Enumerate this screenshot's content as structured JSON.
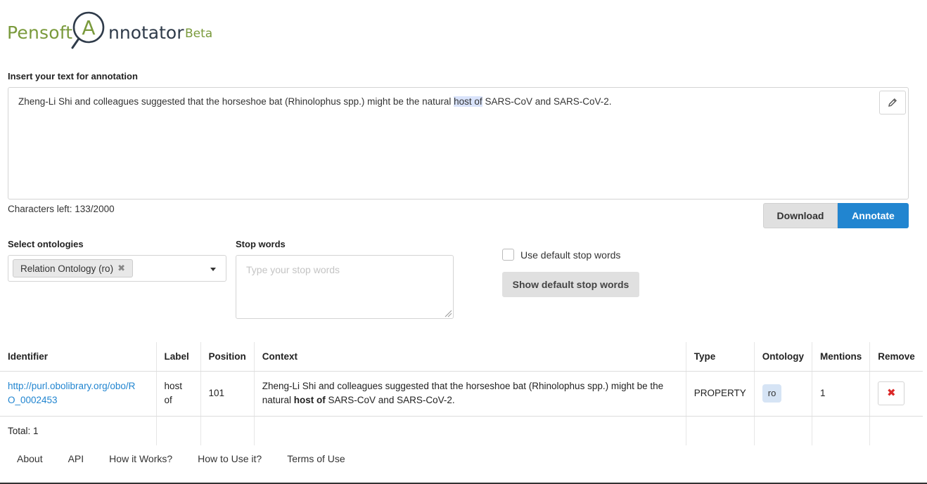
{
  "logo": {
    "pensoft": "Pensoft",
    "nnotator": "nnotator",
    "beta": "Beta",
    "mark_letter": "A"
  },
  "input": {
    "label": "Insert your text for annotation",
    "text_before": "Zheng-Li Shi and colleagues suggested that the horseshoe bat (Rhinolophus spp.) might be the natural ",
    "text_highlight": "host of",
    "text_after": " SARS-CoV and SARS-CoV-2.",
    "chars_left": "Characters left: 133/2000"
  },
  "actions": {
    "download": "Download",
    "annotate": "Annotate"
  },
  "ontologies": {
    "label": "Select ontologies",
    "selected": "Relation Ontology (ro)",
    "remove_symbol": "✖"
  },
  "stopwords": {
    "label": "Stop words",
    "placeholder": "Type your stop words",
    "use_default_label": "Use default stop words",
    "show_default": "Show default stop words"
  },
  "table": {
    "headers": [
      "Identifier",
      "Label",
      "Position",
      "Context",
      "Type",
      "Ontology",
      "Mentions",
      "Remove"
    ],
    "rows": [
      {
        "identifier_line1": "http://purl.obolibrary.org/obo/R",
        "identifier_line2": "O_0002453",
        "label_line1": "host",
        "label_line2": "of",
        "position": "101",
        "context_line1": "Zheng-Li Shi and colleagues suggested that the horseshoe bat (Rhinolophus spp.) might be the",
        "context_pre": "natural ",
        "context_bold": "host of",
        "context_post": " SARS-CoV and SARS-CoV-2.",
        "type": "PROPERTY",
        "ontology": "ro",
        "mentions": "1",
        "remove_symbol": "✖"
      }
    ],
    "total": "Total: 1"
  },
  "footer": {
    "links": [
      "About",
      "API",
      "How it Works?",
      "How to Use it?",
      "Terms of Use"
    ]
  },
  "colors": {
    "brand_green": "#7a9a3c",
    "primary_blue": "#2185d0",
    "danger_red": "#db2828"
  }
}
